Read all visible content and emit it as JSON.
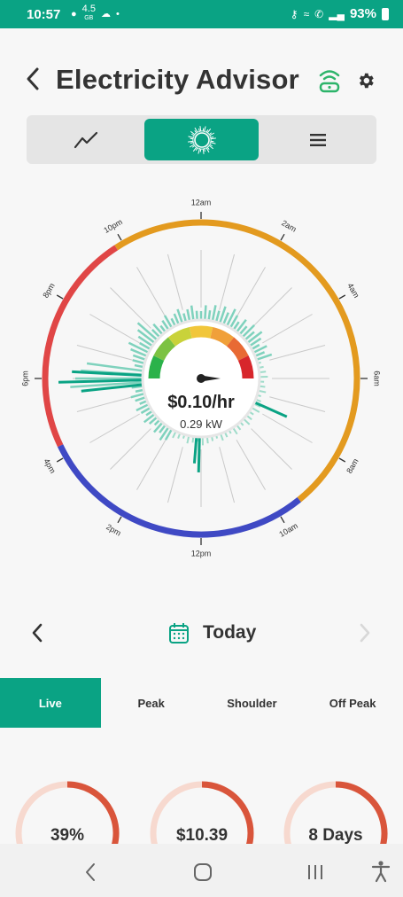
{
  "status": {
    "time": "10:57",
    "data_speed": "4.5",
    "data_unit": "GB",
    "battery": "93%"
  },
  "header": {
    "title": "Electricity Advisor"
  },
  "view_toggle": {
    "options": [
      "chart-line-icon",
      "sun-dial-icon",
      "list-icon"
    ],
    "active": "sun-dial-icon"
  },
  "dial": {
    "hour_labels": [
      "12am",
      "2am",
      "4am",
      "6am",
      "8am",
      "10am",
      "12pm",
      "2pm",
      "4pm",
      "6pm",
      "8pm",
      "10pm"
    ],
    "price": "$0.10/hr",
    "power": "0.29 kW",
    "tariff_colors": {
      "peak": "#e04646",
      "shoulder": "#e39a1f",
      "off_peak": "#3f49c4"
    }
  },
  "day_nav": {
    "label": "Today"
  },
  "tabs": [
    "Live",
    "Peak",
    "Shoulder",
    "Off Peak"
  ],
  "active_tab": "Live",
  "summary": {
    "gauges": [
      {
        "value": "39%",
        "fraction": 0.39
      },
      {
        "value": "$10.39",
        "fraction": 0.5
      },
      {
        "value": "8 Days",
        "fraction": 0.45
      }
    ]
  },
  "colors": {
    "accent": "#0aa384",
    "gauge_arc": "#d9553b",
    "gauge_track": "#f7d9cf"
  }
}
